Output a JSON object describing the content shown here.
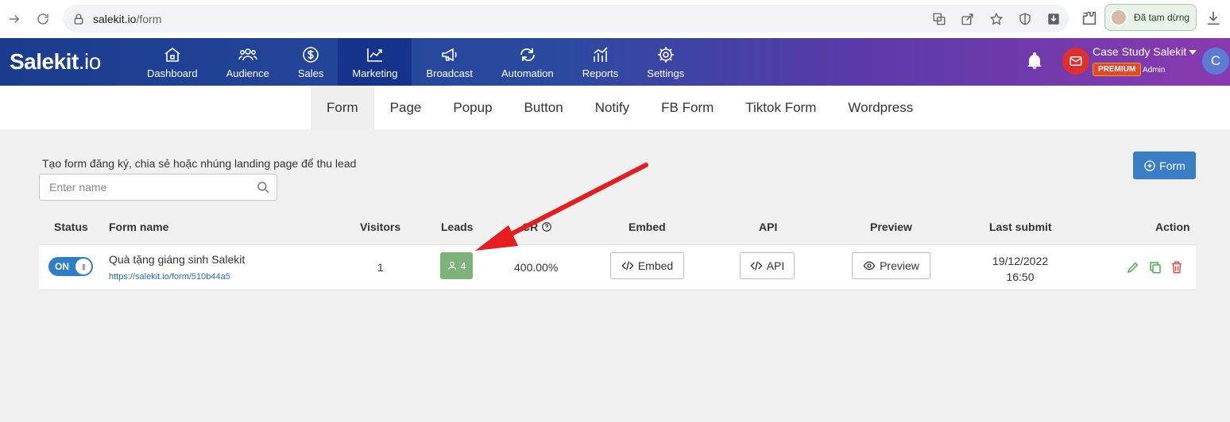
{
  "browser": {
    "url_host": "salekit.io",
    "url_path": "/form",
    "profile_label": "Đã tạm dừng"
  },
  "app": {
    "logo_main": "Salekit",
    "logo_suffix": ".io",
    "nav": [
      {
        "label": "Dashboard",
        "icon": "home-icon"
      },
      {
        "label": "Audience",
        "icon": "users-icon"
      },
      {
        "label": "Sales",
        "icon": "dollar-icon"
      },
      {
        "label": "Marketing",
        "icon": "chart-icon",
        "active": true
      },
      {
        "label": "Broadcast",
        "icon": "megaphone-icon"
      },
      {
        "label": "Automation",
        "icon": "refresh-icon"
      },
      {
        "label": "Reports",
        "icon": "reports-icon"
      },
      {
        "label": "Settings",
        "icon": "gear-icon"
      }
    ],
    "account_name": "Case Study Salekit",
    "plan_badge": "PREMIUM",
    "role": "Admin",
    "avatar_initial": "C"
  },
  "subnav": {
    "tabs": [
      "Form",
      "Page",
      "Popup",
      "Button",
      "Notify",
      "FB Form",
      "Tiktok Form",
      "Wordpress"
    ],
    "active": "Form"
  },
  "content": {
    "description": "Tạo form đăng ký, chia sẻ hoặc nhúng landing page để thu lead",
    "search_placeholder": "Enter name",
    "add_button_label": "Form"
  },
  "table": {
    "headers": {
      "status": "Status",
      "form_name": "Form name",
      "visitors": "Visitors",
      "leads": "Leads",
      "cr": "CR",
      "embed": "Embed",
      "api": "API",
      "preview": "Preview",
      "last_submit": "Last submit",
      "action": "Action"
    },
    "rows": [
      {
        "status": "ON",
        "name": "Quà tặng giáng sinh Salekit",
        "link": "https://salekit.io/form/510b44a5",
        "visitors": "1",
        "leads": "4",
        "cr": "400.00%",
        "embed_label": "Embed",
        "api_label": "API",
        "preview_label": "Preview",
        "last_submit_date": "19/12/2022",
        "last_submit_time": "16:50"
      }
    ]
  },
  "colors": {
    "header_start": "#1a3c8e",
    "header_end": "#8a3ab0",
    "primary": "#3a7ec6",
    "leads_badge": "#7db37a",
    "annotation_arrow": "#e41e1e"
  }
}
